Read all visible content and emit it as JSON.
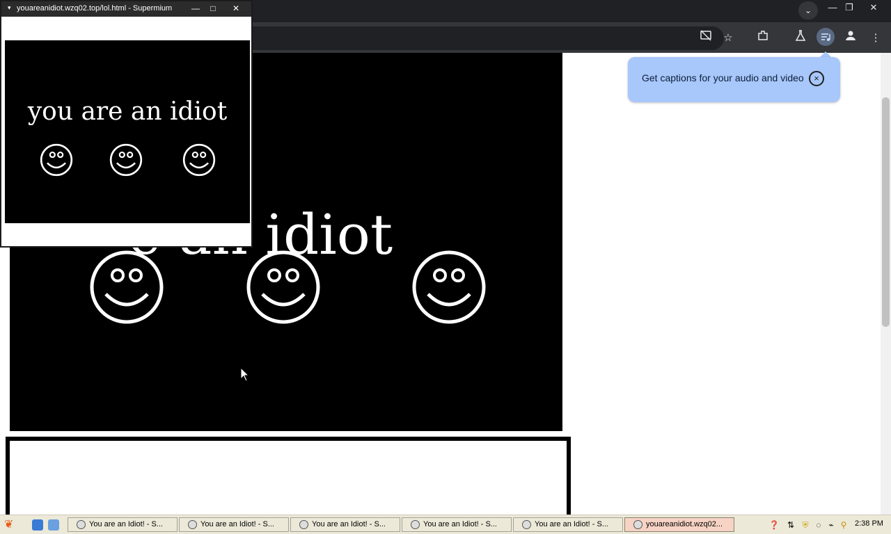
{
  "browser": {
    "tab_search_icon": "chevron-down-icon",
    "window_controls": {
      "minimize": "—",
      "restore": "❐",
      "close": "✕"
    },
    "toolbar_icons": [
      "cast-off-icon",
      "star-icon",
      "extensions-icon",
      "labs-icon",
      "media-controls-icon",
      "profile-icon",
      "menu-icon"
    ]
  },
  "page": {
    "headline": "you are an idiot",
    "visible_headline": "e an idiot",
    "smiley_count": 3
  },
  "captions_bubble": {
    "text": "Get captions for your audio and video",
    "close_symbol": "×",
    "color": "#a8c7fa"
  },
  "popup_window": {
    "title": "youareanidiot.wzq02.top/lol.html - Supermium",
    "controls": {
      "minimize": "—",
      "maximize": "□",
      "close": "✕"
    },
    "headline": "you are an idiot",
    "smiley_count": 3
  },
  "taskbar": {
    "tasks": [
      {
        "label": "You are an Idiot! - S...",
        "active": false
      },
      {
        "label": "You are an Idiot! - S...",
        "active": false
      },
      {
        "label": "You are an Idiot! - S...",
        "active": false
      },
      {
        "label": "You are an Idiot! - S...",
        "active": false
      },
      {
        "label": "You are an Idiot! - S...",
        "active": false
      },
      {
        "label": "youareanidiot.wzq02...",
        "active": true
      }
    ],
    "clock": "2:38 PM"
  }
}
